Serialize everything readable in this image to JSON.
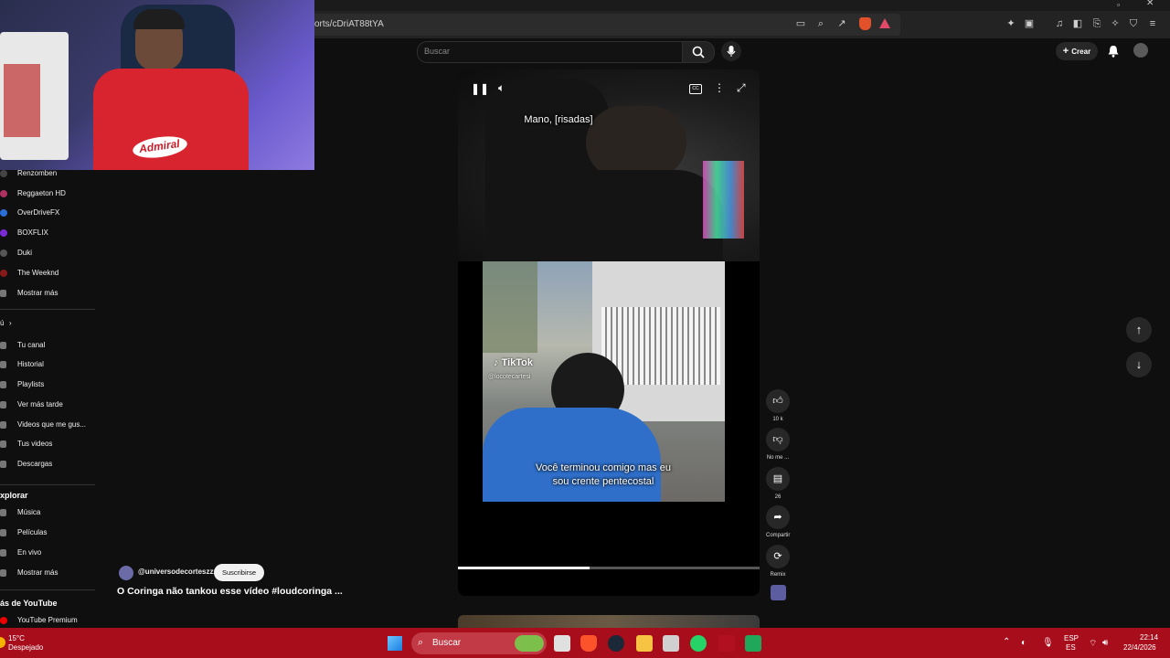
{
  "browser": {
    "url": "orts/cDriAT88tYA"
  },
  "youtube": {
    "search_placeholder": "Buscar",
    "create_label": "Crear"
  },
  "sidebar": {
    "subscriptions": [
      {
        "label": "Renzomben",
        "color": "#444"
      },
      {
        "label": "Reggaeton HD",
        "color": "#b03060"
      },
      {
        "label": "OverDriveFX",
        "color": "#2b6fd6"
      },
      {
        "label": "BOXFLIX",
        "color": "#7a2bd6"
      },
      {
        "label": "Duki",
        "color": "#555"
      },
      {
        "label": "The Weeknd",
        "color": "#8a1a1a"
      },
      {
        "label": "Mostrar más",
        "color": "#666"
      }
    ],
    "you_header": "ú",
    "you_items": [
      "Tu canal",
      "Historial",
      "Playlists",
      "Ver más tarde",
      "Videos que me gus...",
      "Tus videos",
      "Descargas"
    ],
    "explore_header": "xplorar",
    "explore_items": [
      "Música",
      "Películas",
      "En vivo",
      "Mostrar más"
    ],
    "more_header": "ás de YouTube",
    "more_items": [
      "YouTube Premium"
    ]
  },
  "video": {
    "caption_top": "Mano, [risadas]",
    "caption_bottom_1": "Você terminou comigo mas eu",
    "caption_bottom_2": "sou crente pentecostal",
    "tiktok_label": "TikTok",
    "tiktok_handle": "@locotecartesi",
    "cc_label": "CC",
    "progress": 0.435
  },
  "actions": {
    "like_count": "10 k",
    "dislike_label": "No me ...",
    "comment_count": "26",
    "share_label": "Compartir",
    "remix_label": "Remix"
  },
  "channel": {
    "handle": "@universodecorteszzz",
    "subscribe_label": "Suscribirse",
    "title": "O Coringa não tankou esse vídeo #loudcoringa ..."
  },
  "taskbar": {
    "weather_temp": "15°C",
    "weather_desc": "Despejado",
    "search_label": "Buscar",
    "lang_1": "ESP",
    "lang_2": "ES",
    "time": "22:14",
    "date": "22/4/2026"
  },
  "webcam": {
    "jersey_text": "Admiral"
  }
}
